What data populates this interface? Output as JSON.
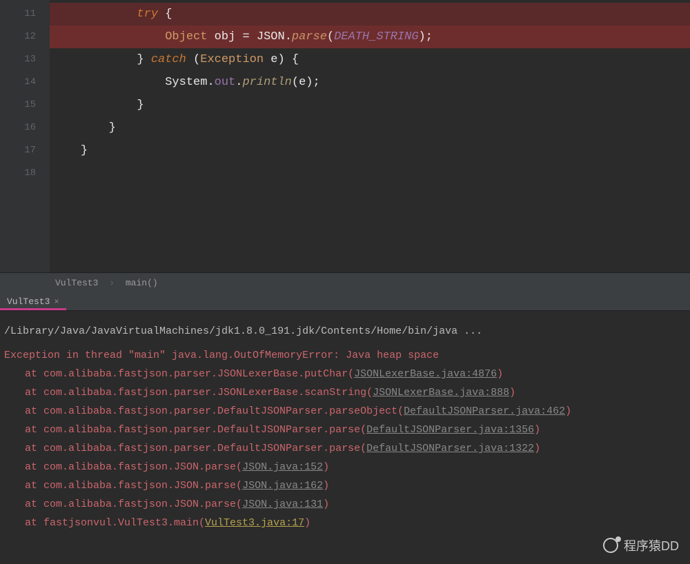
{
  "editor": {
    "lines": [
      {
        "num": "11",
        "breakpoint": true,
        "highlight": "bp",
        "tokens": [
          {
            "t": "            ",
            "c": ""
          },
          {
            "t": "try",
            "c": "kw"
          },
          {
            "t": " {",
            "c": "brace"
          }
        ]
      },
      {
        "num": "12",
        "breakpoint": true,
        "highlight": "current",
        "tokens": [
          {
            "t": "                ",
            "c": ""
          },
          {
            "t": "Object",
            "c": "type"
          },
          {
            "t": " obj ",
            "c": "ident"
          },
          {
            "t": "=",
            "c": "op"
          },
          {
            "t": " ",
            "c": ""
          },
          {
            "t": "JSON",
            "c": "ident"
          },
          {
            "t": ".",
            "c": "op"
          },
          {
            "t": "parse",
            "c": "methoditalic"
          },
          {
            "t": "(",
            "c": "paren"
          },
          {
            "t": "DEATH_STRING",
            "c": "constf"
          },
          {
            "t": ")",
            "c": "paren"
          },
          {
            "t": ";",
            "c": "op"
          }
        ]
      },
      {
        "num": "13",
        "tokens": [
          {
            "t": "            ",
            "c": ""
          },
          {
            "t": "}",
            "c": "brace"
          },
          {
            "t": " ",
            "c": ""
          },
          {
            "t": "catch",
            "c": "kw"
          },
          {
            "t": " (",
            "c": "paren"
          },
          {
            "t": "Exception",
            "c": "type"
          },
          {
            "t": " e",
            "c": "ident"
          },
          {
            "t": ")",
            "c": "paren"
          },
          {
            "t": " {",
            "c": "brace"
          }
        ]
      },
      {
        "num": "14",
        "tokens": [
          {
            "t": "                ",
            "c": ""
          },
          {
            "t": "System",
            "c": "ident"
          },
          {
            "t": ".",
            "c": "op"
          },
          {
            "t": "out",
            "c": "field"
          },
          {
            "t": ".",
            "c": "op"
          },
          {
            "t": "println",
            "c": "method"
          },
          {
            "t": "(",
            "c": "paren"
          },
          {
            "t": "e",
            "c": "ident"
          },
          {
            "t": ")",
            "c": "paren"
          },
          {
            "t": ";",
            "c": "op"
          }
        ]
      },
      {
        "num": "15",
        "tokens": [
          {
            "t": "            ",
            "c": ""
          },
          {
            "t": "}",
            "c": "brace"
          }
        ]
      },
      {
        "num": "16",
        "tokens": [
          {
            "t": "        ",
            "c": ""
          },
          {
            "t": "}",
            "c": "brace"
          }
        ]
      },
      {
        "num": "17",
        "tokens": [
          {
            "t": "    ",
            "c": ""
          },
          {
            "t": "}",
            "c": "brace"
          }
        ]
      },
      {
        "num": "18",
        "tokens": []
      }
    ]
  },
  "breadcrumb": {
    "class": "VulTest3",
    "method": "main()"
  },
  "tab": {
    "title": "VulTest3"
  },
  "console": {
    "cmd": "/Library/Java/JavaVirtualMachines/jdk1.8.0_191.jdk/Contents/Home/bin/java ...",
    "exception": "Exception in thread \"main\" java.lang.OutOfMemoryError: Java heap space",
    "stack": [
      {
        "pre": "at com.alibaba.fastjson.parser.JSONLexerBase.putChar(",
        "link": "JSONLexerBase.java:4876",
        "post": ")"
      },
      {
        "pre": "at com.alibaba.fastjson.parser.JSONLexerBase.scanString(",
        "link": "JSONLexerBase.java:888",
        "post": ")"
      },
      {
        "pre": "at com.alibaba.fastjson.parser.DefaultJSONParser.parseObject(",
        "link": "DefaultJSONParser.java:462",
        "post": ")"
      },
      {
        "pre": "at com.alibaba.fastjson.parser.DefaultJSONParser.parse(",
        "link": "DefaultJSONParser.java:1356",
        "post": ")"
      },
      {
        "pre": "at com.alibaba.fastjson.parser.DefaultJSONParser.parse(",
        "link": "DefaultJSONParser.java:1322",
        "post": ")"
      },
      {
        "pre": "at com.alibaba.fastjson.JSON.parse(",
        "link": "JSON.java:152",
        "post": ")"
      },
      {
        "pre": "at com.alibaba.fastjson.JSON.parse(",
        "link": "JSON.java:162",
        "post": ")"
      },
      {
        "pre": "at com.alibaba.fastjson.JSON.parse(",
        "link": "JSON.java:131",
        "post": ")"
      },
      {
        "pre": "at fastjsonvul.VulTest3.main(",
        "link": "VulTest3.java:17",
        "post": ")",
        "own": true
      }
    ]
  },
  "watermark": "程序猿DD"
}
